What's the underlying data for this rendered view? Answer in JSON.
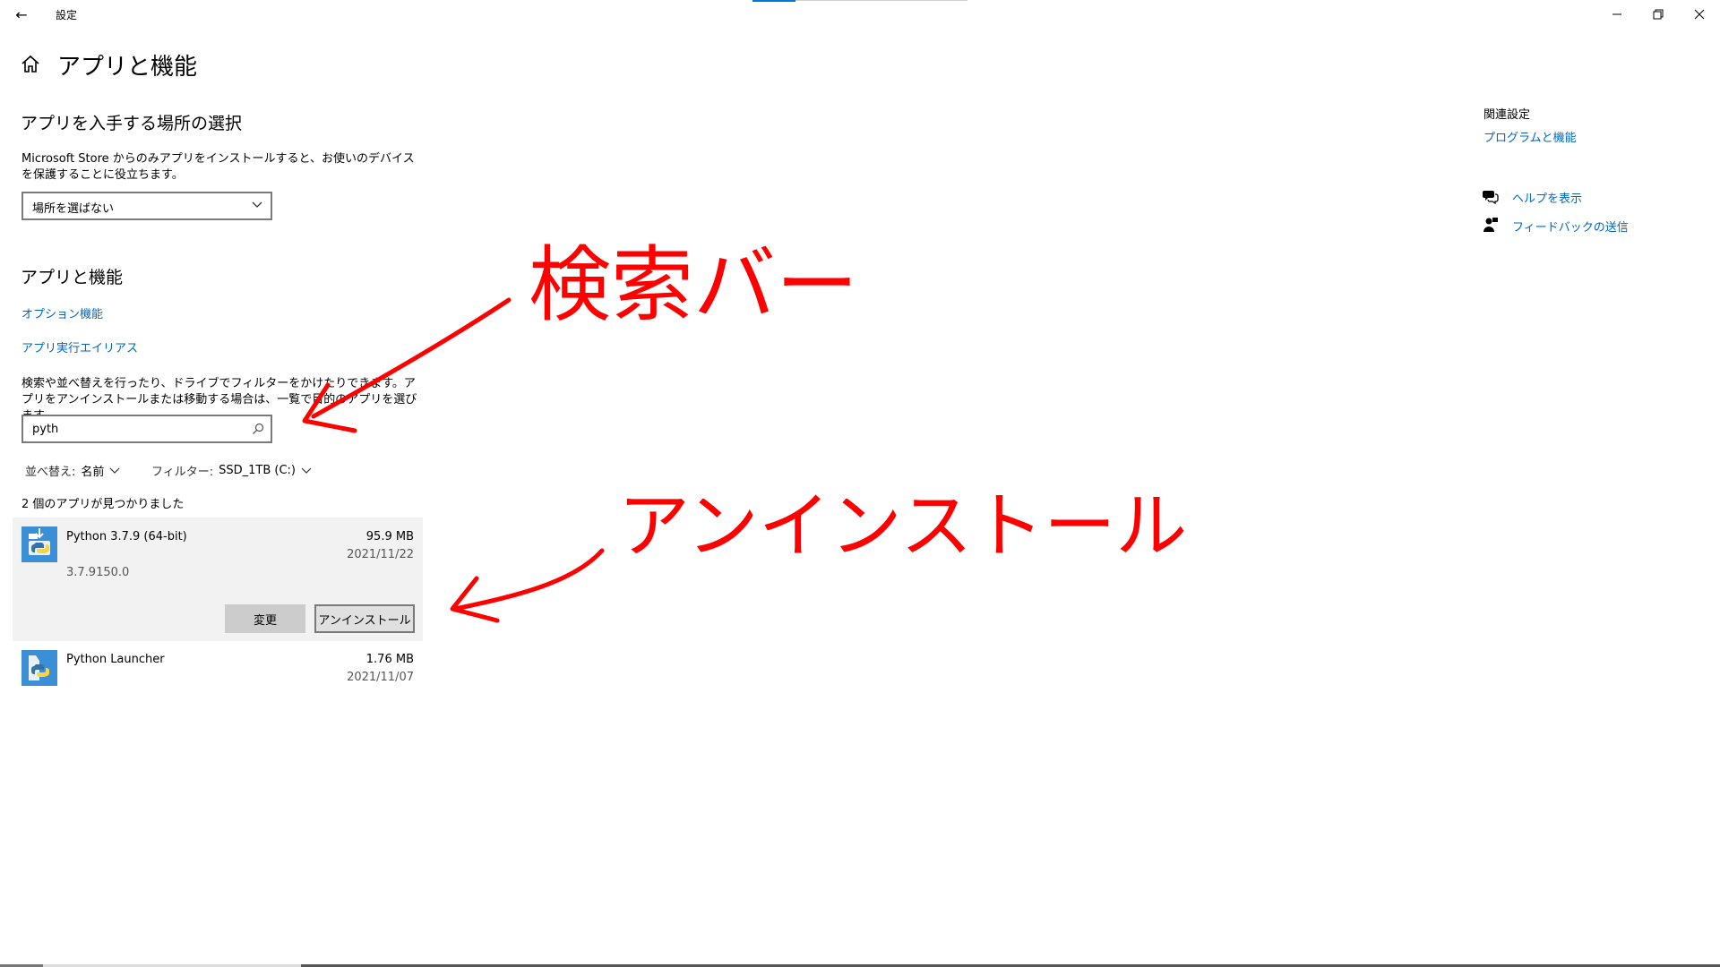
{
  "window": {
    "title": "設定",
    "min_glyph": "—",
    "max_glyph": "❐",
    "close_glyph": "✕",
    "back_glyph": "←"
  },
  "page": {
    "title": "アプリと機能"
  },
  "install_source": {
    "heading": "アプリを入手する場所の選択",
    "description": "Microsoft Store からのみアプリをインストールすると、お使いのデバイスを保護することに役立ちます。",
    "dropdown_value": "場所を選ばない"
  },
  "apps": {
    "heading": "アプリと機能",
    "optional_features_link": "オプション機能",
    "app_aliases_link": "アプリ実行エイリアス",
    "search_help": "検索や並べ替えを行ったり、ドライブでフィルターをかけたりできます。アプリをアンインストールまたは移動する場合は、一覧で目的のアプリを選びます。",
    "search_value": "pyth",
    "sort_label": "並べ替え:",
    "sort_value": "名前",
    "filter_label": "フィルター:",
    "filter_value": "SSD_1TB (C:)",
    "found_count": "2 個のアプリが見つかりました",
    "list": [
      {
        "name": "Python 3.7.9 (64-bit)",
        "size": "95.9 MB",
        "date": "2021/11/22",
        "version": "3.7.9150.0",
        "modify_label": "変更",
        "uninstall_label": "アンインストール"
      },
      {
        "name": "Python Launcher",
        "size": "1.76 MB",
        "date": "2021/11/07"
      }
    ]
  },
  "related": {
    "heading": "関連設定",
    "programs_link": "プログラムと機能",
    "help_link": "ヘルプを表示",
    "feedback_link": "フィードバックの送信"
  },
  "annotations": {
    "search_bar_label": "検索バー",
    "uninstall_label": "アンインストール",
    "color": "#ff0000"
  },
  "colors": {
    "accent": "#0067c0",
    "selected_bg": "#f2f2f2"
  }
}
